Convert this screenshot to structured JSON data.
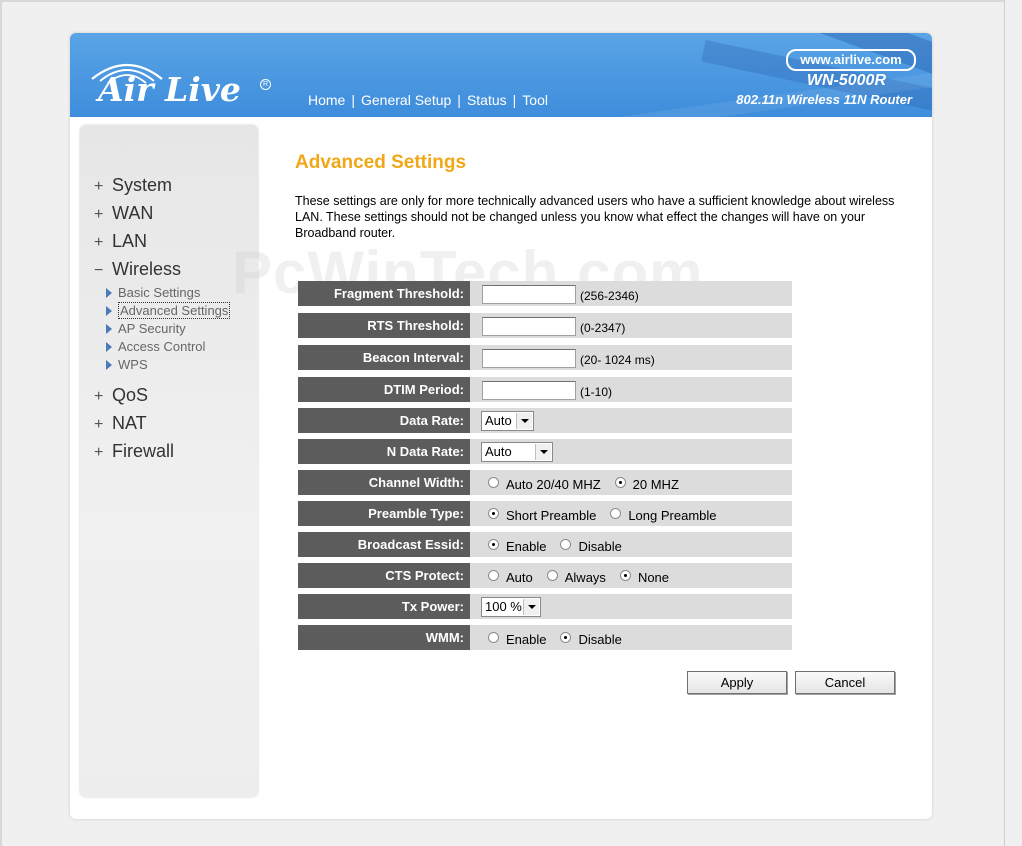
{
  "header": {
    "logo_text": "Air Live",
    "brand_url": "www.airlive.com",
    "model": "WN-5000R",
    "tagline": "802.11n Wireless 11N Router",
    "nav": [
      "Home",
      "General Setup",
      "Status",
      "Tool"
    ]
  },
  "sidebar": {
    "items": [
      {
        "symbol": "+",
        "label": "System"
      },
      {
        "symbol": "+",
        "label": "WAN"
      },
      {
        "symbol": "+",
        "label": "LAN"
      },
      {
        "symbol": "−",
        "label": "Wireless"
      },
      {
        "symbol": "+",
        "label": "QoS"
      },
      {
        "symbol": "+",
        "label": "NAT"
      },
      {
        "symbol": "+",
        "label": "Firewall"
      }
    ],
    "wireless_sub": [
      "Basic Settings",
      "Advanced Settings",
      "AP Security",
      "Access Control",
      "WPS"
    ],
    "active_sub": "Advanced Settings"
  },
  "main": {
    "title": "Advanced Settings",
    "description": "These settings are only for more technically advanced users who have a sufficient knowledge about wireless LAN. These settings should not be changed unless you know what effect the changes will have on your Broadband router.",
    "watermark": "PcWinTech.com",
    "fields": {
      "fragment_threshold": {
        "label": "Fragment Threshold:",
        "value": "",
        "hint": "(256-2346)"
      },
      "rts_threshold": {
        "label": "RTS Threshold:",
        "value": "",
        "hint": "(0-2347)"
      },
      "beacon_interval": {
        "label": "Beacon Interval:",
        "value": "",
        "hint": "(20- 1024 ms)"
      },
      "dtim_period": {
        "label": "DTIM Period:",
        "value": "",
        "hint": "(1-10)"
      },
      "data_rate": {
        "label": "Data Rate:",
        "selected": "Auto"
      },
      "n_data_rate": {
        "label": "N Data Rate:",
        "selected": "Auto"
      },
      "channel_width": {
        "label": "Channel Width:",
        "options": [
          "Auto 20/40 MHZ",
          "20 MHZ"
        ],
        "selected": "20 MHZ"
      },
      "preamble_type": {
        "label": "Preamble Type:",
        "options": [
          "Short Preamble",
          "Long Preamble"
        ],
        "selected": "Short Preamble"
      },
      "broadcast_essid": {
        "label": "Broadcast Essid:",
        "options": [
          "Enable",
          "Disable"
        ],
        "selected": "Enable"
      },
      "cts_protect": {
        "label": "CTS Protect:",
        "options": [
          "Auto",
          "Always",
          "None"
        ],
        "selected": "None"
      },
      "tx_power": {
        "label": "Tx Power:",
        "selected": "100 %"
      },
      "wmm": {
        "label": "WMM:",
        "options": [
          "Enable",
          "Disable"
        ],
        "selected": "Disable"
      }
    },
    "buttons": {
      "apply": "Apply",
      "cancel": "Cancel"
    }
  }
}
